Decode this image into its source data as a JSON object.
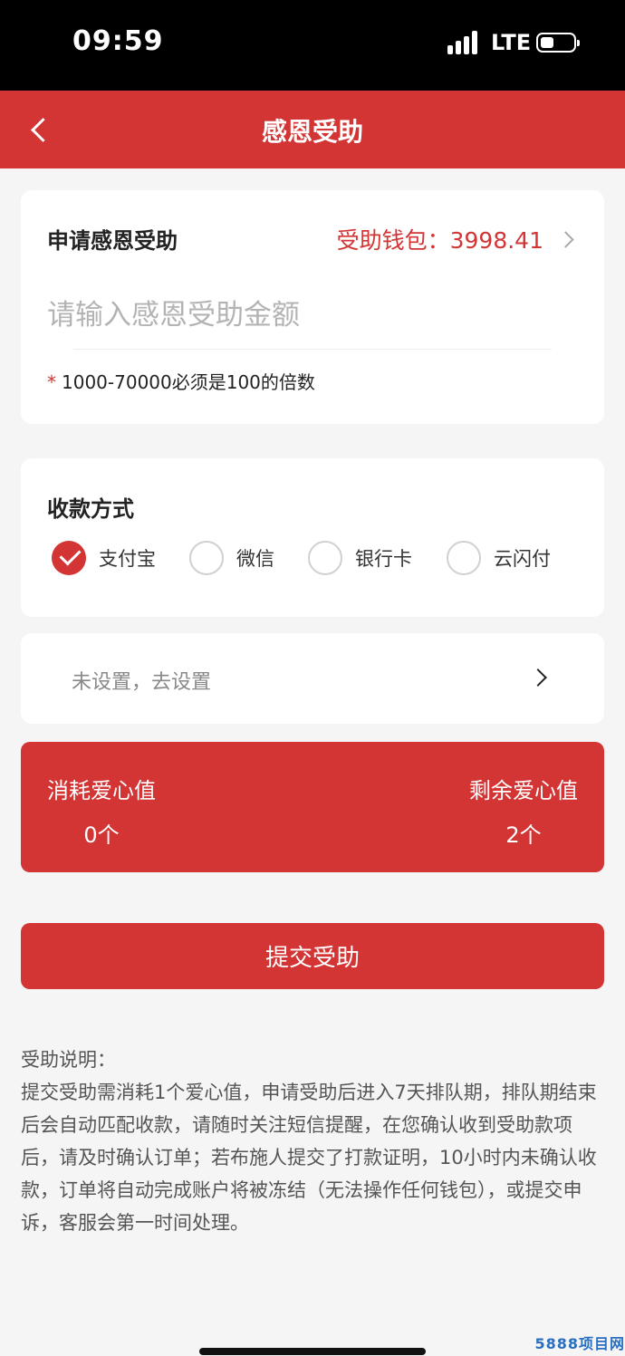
{
  "status_bar": {
    "time": "09:59",
    "network": "LTE"
  },
  "nav": {
    "title": "感恩受助"
  },
  "apply": {
    "title": "申请感恩受助",
    "wallet_label": "受助钱包：3998.41",
    "amount_placeholder": "请输入感恩受助金额",
    "hint_star": "*",
    "hint_text": "1000-70000必须是100的倍数"
  },
  "payment": {
    "title": "收款方式",
    "options": [
      {
        "label": "支付宝",
        "checked": true
      },
      {
        "label": "微信",
        "checked": false
      },
      {
        "label": "银行卡",
        "checked": false
      },
      {
        "label": "云闪付",
        "checked": false
      }
    ]
  },
  "account_setup": {
    "text": "未设置，去设置"
  },
  "love": {
    "consume_label": "消耗爱心值",
    "consume_value": "0个",
    "remain_label": "剩余爱心值",
    "remain_value": "2个"
  },
  "submit_label": "提交受助",
  "notes": {
    "heading": "受助说明：",
    "body": "提交受助需消耗1个爱心值，申请受助后进入7天排队期，排队期结束后会自动匹配收款，请随时关注短信提醒，在您确认收到受助款项后，请及时确认订单；若布施人提交了打款证明，10小时内未确认收款，订单将自动完成账户将被冻结（无法操作任何钱包），或提交申诉，客服会第一时间处理。"
  },
  "watermark": "5888项目网"
}
